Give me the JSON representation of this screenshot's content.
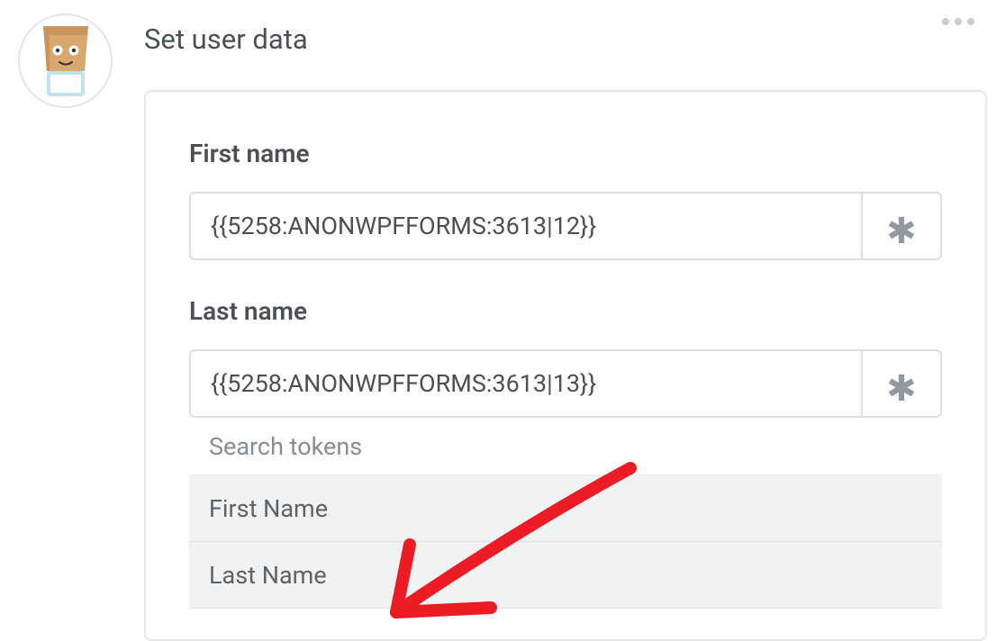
{
  "card": {
    "title": "Set user data"
  },
  "fields": {
    "first_name": {
      "label": "First name",
      "value": "{{5258:ANONWPFFORMS:3613|12}}"
    },
    "last_name": {
      "label": "Last name",
      "value": "{{5258:ANONWPFFORMS:3613|13}}"
    }
  },
  "dropdown": {
    "search_placeholder": "Search tokens",
    "options": [
      {
        "label": "First Name"
      },
      {
        "label": "Last Name"
      }
    ]
  }
}
